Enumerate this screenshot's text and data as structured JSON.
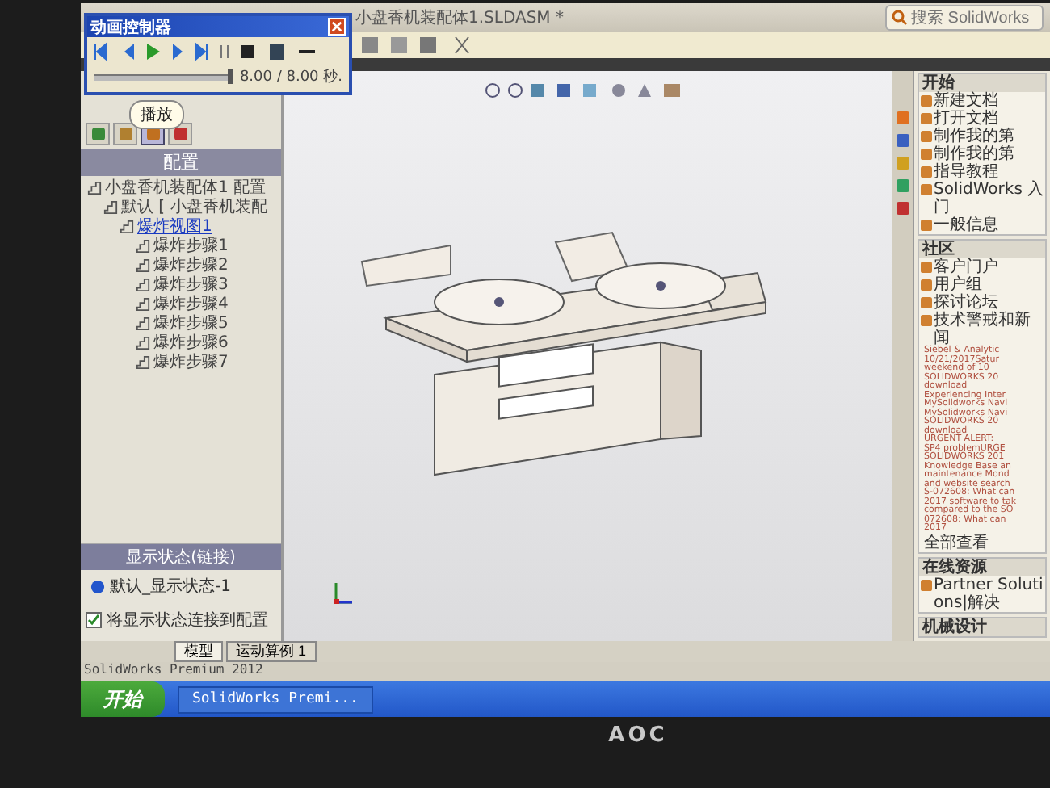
{
  "controller": {
    "title": "动画控制器",
    "time": "8.00 / 8.00 秒.",
    "tooltip": "播放",
    "level": 1
  },
  "window": {
    "title": "小盘香机装配体1.SLDASM *",
    "search_placeholder": "搜索 SolidWorks"
  },
  "left_panel": {
    "tabs": [
      {
        "selected": false
      },
      {
        "selected": false
      },
      {
        "selected": true
      },
      {
        "selected": false
      }
    ],
    "header": "配置",
    "tree": [
      {
        "label": "小盘香机装配体1 配置",
        "selected": false,
        "children": [
          {
            "label": "默认 [ 小盘香机装配",
            "selected": false,
            "children": [
              {
                "label": "爆炸视图1",
                "selected": true,
                "children": [
                  {
                    "label": "爆炸步骤1",
                    "selected": false
                  },
                  {
                    "label": "爆炸步骤2",
                    "selected": false
                  },
                  {
                    "label": "爆炸步骤3",
                    "selected": false
                  },
                  {
                    "label": "爆炸步骤4",
                    "selected": false
                  },
                  {
                    "label": "爆炸步骤5",
                    "selected": false
                  },
                  {
                    "label": "爆炸步骤6",
                    "selected": false
                  },
                  {
                    "label": "爆炸步骤7",
                    "selected": false
                  }
                ]
              }
            ]
          }
        ]
      }
    ],
    "display_state": {
      "header": "显示状态(链接)",
      "items": [
        {
          "label": "默认_显示状态-1"
        }
      ],
      "link": {
        "label": "将显示状态连接到配置",
        "checked": true
      }
    }
  },
  "task_pane": {
    "sections": [
      {
        "title": "开始",
        "items": [
          "新建文档",
          "打开文档",
          "制作我的第",
          "制作我的第",
          "指导教程",
          "SolidWorks 入门",
          "一般信息"
        ]
      },
      {
        "title": "社区",
        "items": [
          "客户门户",
          "用户组",
          "探讨论坛",
          "技术警戒和新闻"
        ],
        "news": [
          "Siebel & Analytic",
          "10/21/2017Satur",
          "weekend of 10",
          "SOLIDWORKS 20",
          "download",
          "Experiencing Inter",
          "MySolidworks Navi",
          "MySolidworks Navi",
          "SOLIDWORKS 20",
          "download",
          "URGENT ALERT:",
          "SP4 problemURGE",
          "SOLIDWORKS 201",
          "Knowledge Base an",
          "maintenance Mond",
          "and website search",
          "S-072608: What can",
          "2017 software to tak",
          "compared to the SO",
          "072608: What can",
          "2017"
        ],
        "more": "全部查看"
      },
      {
        "title": "在线资源",
        "items": [
          "Partner Solutions|解决"
        ]
      },
      {
        "title": "机械设计"
      }
    ]
  },
  "bottom_tabs": [
    {
      "label": "模型",
      "selected": true
    },
    {
      "label": "运动算例 1",
      "selected": false
    }
  ],
  "status_bar": "SolidWorks Premium 2012",
  "taskbar": {
    "start": "开始",
    "tasks": [
      "SolidWorks Premi..."
    ]
  },
  "monitor": {
    "brand": "AOC"
  }
}
